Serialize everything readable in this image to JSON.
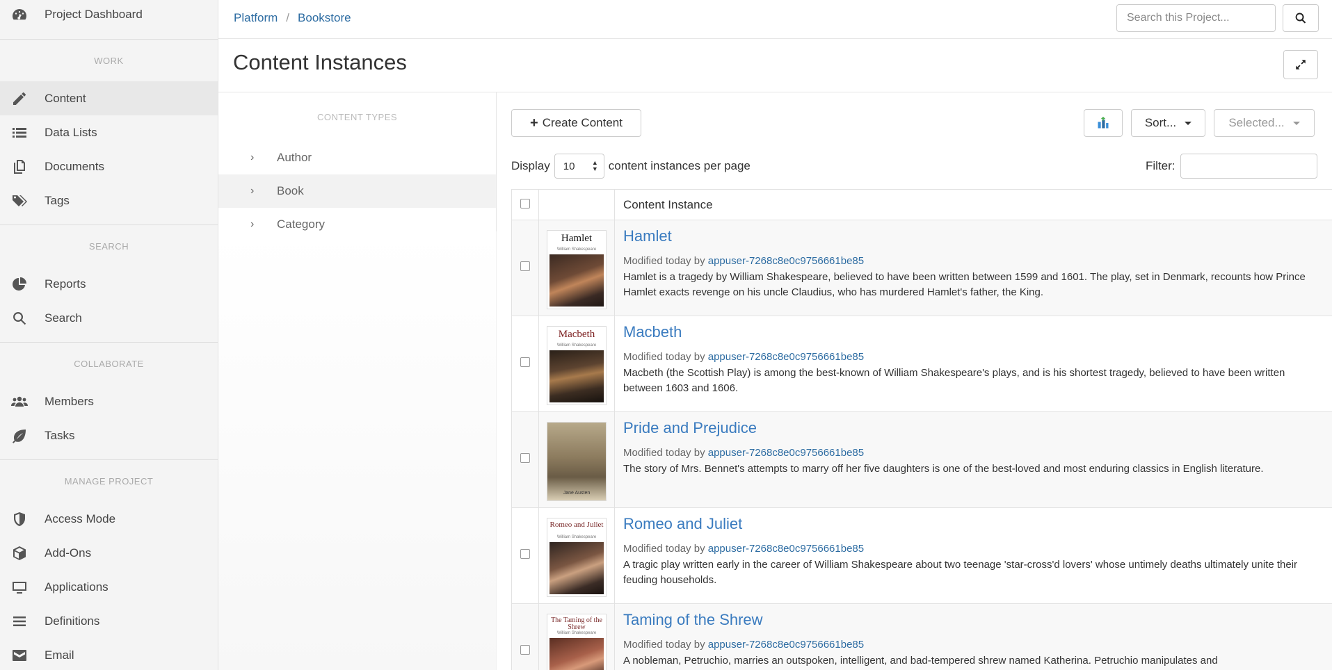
{
  "sidebar": {
    "dashboard": {
      "label": "Project Dashboard",
      "icon": "dashboard-icon"
    },
    "sections": {
      "work": "WORK",
      "search": "SEARCH",
      "collaborate": "COLLABORATE",
      "manage": "MANAGE PROJECT"
    },
    "work_items": [
      {
        "label": "Content",
        "icon": "pencil-icon",
        "active": true
      },
      {
        "label": "Data Lists",
        "icon": "list-icon"
      },
      {
        "label": "Documents",
        "icon": "documents-icon"
      },
      {
        "label": "Tags",
        "icon": "tags-icon"
      }
    ],
    "search_items": [
      {
        "label": "Reports",
        "icon": "pie-chart-icon"
      },
      {
        "label": "Search",
        "icon": "search-icon"
      }
    ],
    "collaborate_items": [
      {
        "label": "Members",
        "icon": "users-icon"
      },
      {
        "label": "Tasks",
        "icon": "leaf-icon"
      }
    ],
    "manage_items": [
      {
        "label": "Access Mode",
        "icon": "shield-icon"
      },
      {
        "label": "Add-Ons",
        "icon": "cube-icon"
      },
      {
        "label": "Applications",
        "icon": "monitor-icon"
      },
      {
        "label": "Definitions",
        "icon": "menu-icon"
      },
      {
        "label": "Email",
        "icon": "email-icon"
      }
    ]
  },
  "topbar": {
    "breadcrumb": [
      "Platform",
      "Bookstore"
    ],
    "breadcrumb_sep": "/",
    "search_placeholder": "Search this Project..."
  },
  "page": {
    "title": "Content Instances"
  },
  "content_types": {
    "heading": "CONTENT TYPES",
    "items": [
      "Author",
      "Book",
      "Category"
    ]
  },
  "toolbar": {
    "create_label": "Create Content",
    "create_symbol": "+",
    "sort_label": "Sort...",
    "selected_label": "Selected..."
  },
  "display": {
    "prefix": "Display",
    "per_page": "10",
    "suffix": "content instances per page",
    "filter_label": "Filter:"
  },
  "table": {
    "column_header": "Content Instance",
    "modified_prefix": "Modified today by",
    "rows": [
      {
        "title": "Hamlet",
        "cover_title": "Hamlet",
        "cover_author": "William Shakespeare",
        "user": "appuser-7268c8e0c9756661be85",
        "description": "Hamlet is a tragedy by William Shakespeare, believed to have been written between 1599 and 1601. The play, set in Denmark, recounts how Prince Hamlet exacts revenge on his uncle Claudius, who has murdered Hamlet's father, the King."
      },
      {
        "title": "Macbeth",
        "cover_title": "Macbeth",
        "cover_author": "William Shakespeare",
        "user": "appuser-7268c8e0c9756661be85",
        "description": "Macbeth (the Scottish Play) is among the best-known of William Shakespeare's plays, and is his shortest tragedy, believed to have been written between 1603 and 1606."
      },
      {
        "title": "Pride and Prejudice",
        "cover_title": "",
        "cover_author": "Jane Austen",
        "user": "appuser-7268c8e0c9756661be85",
        "description": "The story of Mrs. Bennet's attempts to marry off her five daughters is one of the best-loved and most enduring classics in English literature."
      },
      {
        "title": "Romeo and Juliet",
        "cover_title": "Romeo and Juliet",
        "cover_author": "William Shakespeare",
        "user": "appuser-7268c8e0c9756661be85",
        "description": "A tragic play written early in the career of William Shakespeare about two teenage 'star-cross'd lovers' whose untimely deaths ultimately unite their feuding households."
      },
      {
        "title": "Taming of the Shrew",
        "cover_title": "The Taming of the Shrew",
        "cover_author": "William Shakespeare",
        "user": "appuser-7268c8e0c9756661be85",
        "description": "A nobleman, Petruchio, marries an outspoken, intelligent, and bad-tempered shrew named Katherina. Petruchio manipulates and"
      }
    ]
  },
  "colors": {
    "link": "#3a7bbf",
    "accent": "#2d6ca2"
  }
}
